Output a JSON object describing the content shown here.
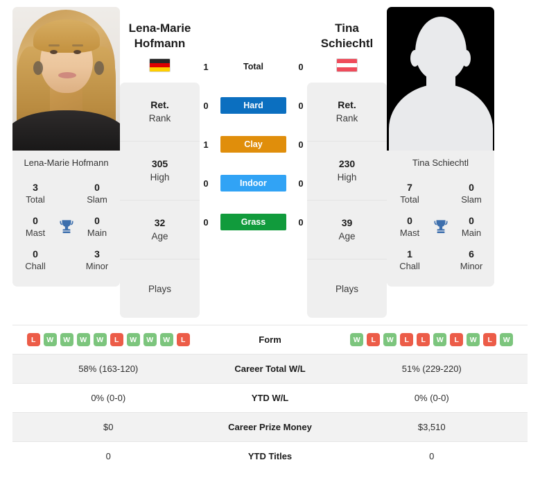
{
  "players": {
    "left": {
      "name_header": "Lena-Marie\nHofmann",
      "name_first": "Lena-Marie",
      "name_last": "Hofmann",
      "caption": "Lena-Marie Hofmann",
      "flag": "germany-flag",
      "flag_colors": [
        "#262626",
        "#dd0000",
        "#ffce00"
      ],
      "photo": "player-photo",
      "titles": {
        "total_value": "3",
        "total_label": "Total",
        "slam_value": "0",
        "slam_label": "Slam",
        "mast_value": "0",
        "mast_label": "Mast",
        "main_value": "0",
        "main_label": "Main",
        "chall_value": "0",
        "chall_label": "Chall",
        "minor_value": "3",
        "minor_label": "Minor"
      },
      "info": [
        {
          "value": "Ret.",
          "label": "Rank"
        },
        {
          "value": "305",
          "label": "High"
        },
        {
          "value": "32",
          "label": "Age"
        },
        {
          "value": "",
          "label": "Plays"
        }
      ],
      "form": [
        "L",
        "W",
        "W",
        "W",
        "W",
        "L",
        "W",
        "W",
        "W",
        "L"
      ]
    },
    "right": {
      "name_first": "Tina",
      "name_last": "Schiechtl",
      "caption": "Tina Schiechtl",
      "flag": "austria-flag",
      "flag_colors": [
        "#ef4b5b",
        "#ffffff",
        "#ef4b5b"
      ],
      "photo": "player-photo-placeholder",
      "titles": {
        "total_value": "7",
        "total_label": "Total",
        "slam_value": "0",
        "slam_label": "Slam",
        "mast_value": "0",
        "mast_label": "Mast",
        "main_value": "0",
        "main_label": "Main",
        "chall_value": "1",
        "chall_label": "Chall",
        "minor_value": "6",
        "minor_label": "Minor"
      },
      "info": [
        {
          "value": "Ret.",
          "label": "Rank"
        },
        {
          "value": "230",
          "label": "High"
        },
        {
          "value": "39",
          "label": "Age"
        },
        {
          "value": "",
          "label": "Plays"
        }
      ],
      "form": [
        "W",
        "L",
        "W",
        "L",
        "L",
        "W",
        "L",
        "W",
        "L",
        "W"
      ]
    }
  },
  "surfaces": [
    {
      "label": "Total",
      "left": "1",
      "right": "0",
      "color": "transparent",
      "text_color": "#1b1b1b"
    },
    {
      "label": "Hard",
      "left": "0",
      "right": "0",
      "color": "#0b6fc0",
      "text_color": "#ffffff"
    },
    {
      "label": "Clay",
      "left": "1",
      "right": "0",
      "color": "#e08e0b",
      "text_color": "#ffffff"
    },
    {
      "label": "Indoor",
      "left": "0",
      "right": "0",
      "color": "#31a3f5",
      "text_color": "#ffffff"
    },
    {
      "label": "Grass",
      "left": "0",
      "right": "0",
      "color": "#119b3c",
      "text_color": "#ffffff"
    }
  ],
  "table": {
    "form_label": "Form",
    "rows": [
      {
        "label": "Career Total W/L",
        "left": "58% (163-120)",
        "right": "51% (229-220)"
      },
      {
        "label": "YTD W/L",
        "left": "0% (0-0)",
        "right": "0% (0-0)"
      },
      {
        "label": "Career Prize Money",
        "left": "$0",
        "right": "$3,510"
      },
      {
        "label": "YTD Titles",
        "left": "0",
        "right": "0"
      }
    ]
  },
  "colors": {
    "win_badge": "#7cc57d",
    "loss_badge": "#ec5c48",
    "card_bg": "#efefef",
    "row_alt_bg": "#f2f2f2",
    "trophy": "#3d6fad"
  }
}
